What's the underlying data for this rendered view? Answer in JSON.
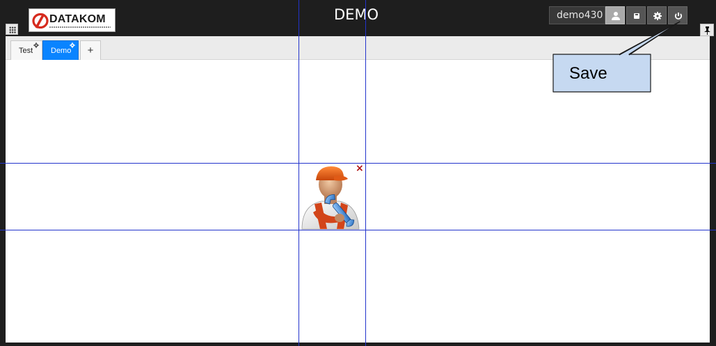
{
  "header": {
    "title": "DEMO",
    "username": "demo430",
    "logo_text": "DATAKOM",
    "brand_color": "#d62b1e",
    "icons": [
      "apps-grid-icon",
      "user-icon",
      "save-icon",
      "settings-gear-icon",
      "power-icon",
      "pin-icon"
    ]
  },
  "tabs": [
    {
      "label": "Test",
      "active": false
    },
    {
      "label": "Demo",
      "active": true
    }
  ],
  "tab_add_label": "+",
  "grid": {
    "line_color": "#2233cc"
  },
  "widget": {
    "icon": "technician-wrench-icon",
    "close_label": "×"
  },
  "callout": {
    "text": "Save",
    "fill": "#c6d9f1"
  },
  "colors": {
    "active_tab": "#0a84ff",
    "header_bg": "#1e1e1e"
  }
}
